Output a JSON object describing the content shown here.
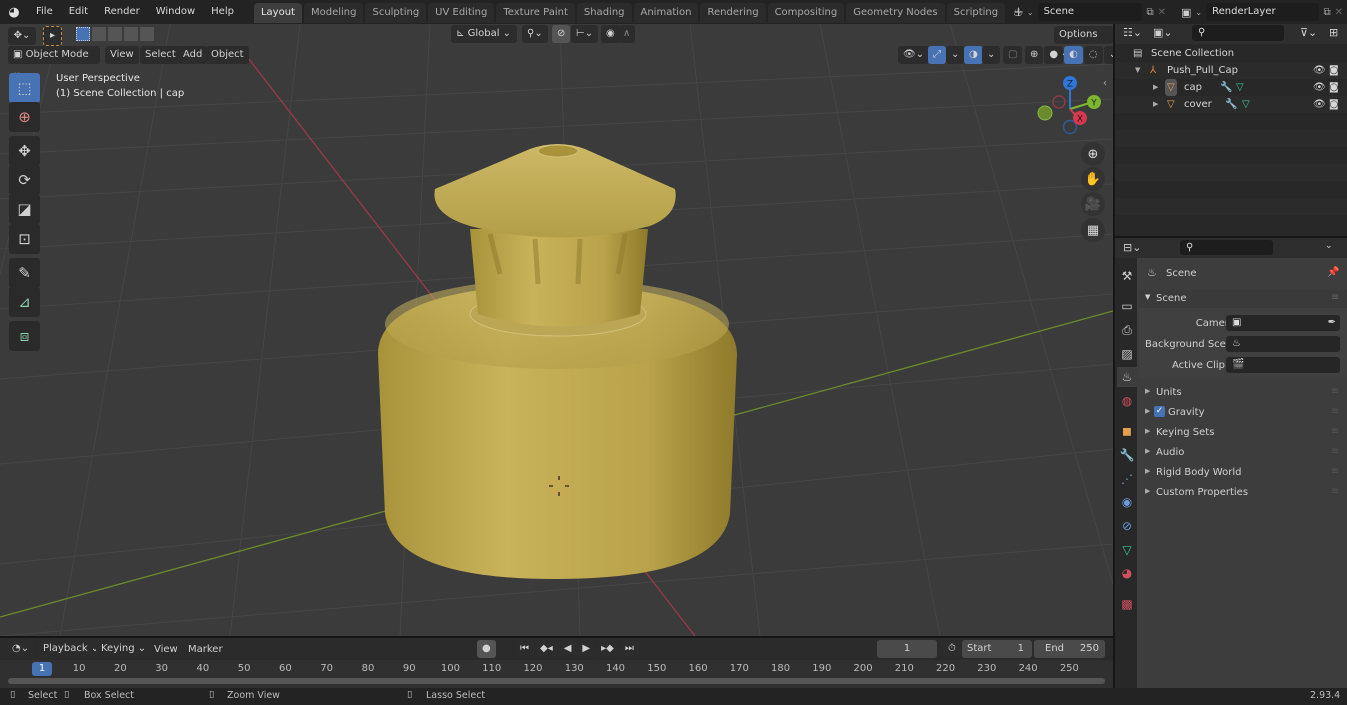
{
  "topbar": {
    "menus": [
      "File",
      "Edit",
      "Render",
      "Window",
      "Help"
    ],
    "workspaces": [
      "Layout",
      "Modeling",
      "Sculpting",
      "UV Editing",
      "Texture Paint",
      "Shading",
      "Animation",
      "Rendering",
      "Compositing",
      "Geometry Nodes",
      "Scripting"
    ],
    "active_workspace": "Layout",
    "add_tab": "+",
    "scene_name": "Scene",
    "view_layer": "RenderLayer"
  },
  "viewport": {
    "mode": "Object Mode",
    "menus": [
      "View",
      "Select",
      "Add",
      "Object"
    ],
    "transform_orientation": "Global",
    "options_label": "Options",
    "overlay_title": "User Perspective",
    "overlay_subtitle": "(1) Scene Collection | cap",
    "gizmo": {
      "x": "X",
      "y": "Y",
      "z": "Z"
    },
    "object_color": "#c8b25a"
  },
  "outliner": {
    "root": "Scene Collection",
    "collection": "Push_Pull_Cap",
    "objects": [
      {
        "name": "cap",
        "selected": true
      },
      {
        "name": "cover",
        "selected": false
      }
    ]
  },
  "properties": {
    "context_title": "Scene",
    "panel_title": "Scene",
    "fields": [
      {
        "label": "Camera",
        "value": ""
      },
      {
        "label": "Background Sce...",
        "value": ""
      },
      {
        "label": "Active Clip",
        "value": ""
      }
    ],
    "subpanels": [
      {
        "label": "Units",
        "checkbox": false
      },
      {
        "label": "Gravity",
        "checkbox": true
      },
      {
        "label": "Keying Sets",
        "checkbox": false
      },
      {
        "label": "Audio",
        "checkbox": false
      },
      {
        "label": "Rigid Body World",
        "checkbox": false
      },
      {
        "label": "Custom Properties",
        "checkbox": false
      }
    ]
  },
  "timeline": {
    "menus": [
      "Playback",
      "Keying",
      "View",
      "Marker"
    ],
    "current_frame": "1",
    "start_label": "Start",
    "start": "1",
    "end_label": "End",
    "end": "250",
    "ticks": [
      "10",
      "20",
      "30",
      "40",
      "50",
      "60",
      "70",
      "80",
      "90",
      "100",
      "110",
      "120",
      "130",
      "140",
      "150",
      "160",
      "170",
      "180",
      "190",
      "200",
      "210",
      "220",
      "230",
      "240",
      "250"
    ],
    "playhead": "1"
  },
  "statusbar": {
    "select": "Select",
    "box_select": "Box Select",
    "zoom_view": "Zoom View",
    "lasso_select": "Lasso Select",
    "version": "2.93.4"
  }
}
